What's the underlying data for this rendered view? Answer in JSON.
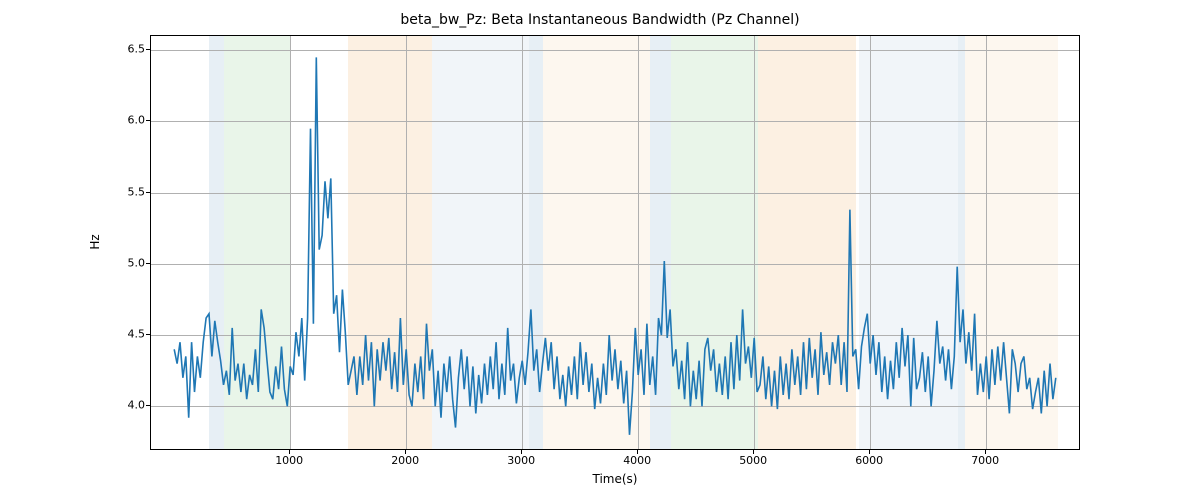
{
  "chart_data": {
    "type": "line",
    "title": "beta_bw_Pz: Beta Instantaneous Bandwidth (Pz Channel)",
    "xlabel": "Time(s)",
    "ylabel": "Hz",
    "xlim": [
      -200,
      7800
    ],
    "ylim": [
      3.7,
      6.6
    ],
    "xticks": [
      1000,
      2000,
      3000,
      4000,
      5000,
      6000,
      7000
    ],
    "yticks": [
      4.0,
      4.5,
      5.0,
      5.5,
      6.0,
      6.5
    ],
    "bands": [
      {
        "x0": 300,
        "x1": 430,
        "color": "#9fbfd9"
      },
      {
        "x0": 430,
        "x1": 1000,
        "color": "#a8d8a8"
      },
      {
        "x0": 1500,
        "x1": 2220,
        "color": "#f5c58b"
      },
      {
        "x0": 2220,
        "x1": 3060,
        "color": "#c8d8e8"
      },
      {
        "x0": 3060,
        "x1": 3180,
        "color": "#9fbfd9"
      },
      {
        "x0": 3180,
        "x1": 4100,
        "color": "#f8e0c0"
      },
      {
        "x0": 4100,
        "x1": 4280,
        "color": "#9fbfd9"
      },
      {
        "x0": 4280,
        "x1": 5030,
        "color": "#a8d8a8"
      },
      {
        "x0": 5030,
        "x1": 5080,
        "color": "#f5c58b"
      },
      {
        "x0": 5080,
        "x1": 5880,
        "color": "#f5c58b"
      },
      {
        "x0": 5900,
        "x1": 6760,
        "color": "#c8d8e8"
      },
      {
        "x0": 6760,
        "x1": 6820,
        "color": "#9fbfd9"
      },
      {
        "x0": 6820,
        "x1": 7620,
        "color": "#f8e0c0"
      }
    ],
    "series": [
      {
        "name": "beta_bw_Pz",
        "color": "#1f77b4",
        "x": [
          0,
          25,
          50,
          75,
          100,
          125,
          150,
          175,
          200,
          225,
          250,
          275,
          300,
          325,
          350,
          375,
          400,
          425,
          450,
          475,
          500,
          525,
          550,
          575,
          600,
          625,
          650,
          675,
          700,
          725,
          750,
          775,
          800,
          825,
          850,
          875,
          900,
          925,
          950,
          975,
          1000,
          1025,
          1050,
          1075,
          1100,
          1125,
          1150,
          1175,
          1200,
          1225,
          1250,
          1275,
          1300,
          1325,
          1350,
          1375,
          1400,
          1425,
          1450,
          1475,
          1500,
          1525,
          1550,
          1575,
          1600,
          1625,
          1650,
          1675,
          1700,
          1725,
          1750,
          1775,
          1800,
          1825,
          1850,
          1875,
          1900,
          1925,
          1950,
          1975,
          2000,
          2025,
          2050,
          2075,
          2100,
          2125,
          2150,
          2175,
          2200,
          2225,
          2250,
          2275,
          2300,
          2325,
          2350,
          2375,
          2400,
          2425,
          2450,
          2475,
          2500,
          2525,
          2550,
          2575,
          2600,
          2625,
          2650,
          2675,
          2700,
          2725,
          2750,
          2775,
          2800,
          2825,
          2850,
          2875,
          2900,
          2925,
          2950,
          2975,
          3000,
          3025,
          3050,
          3075,
          3100,
          3125,
          3150,
          3175,
          3200,
          3225,
          3250,
          3275,
          3300,
          3325,
          3350,
          3375,
          3400,
          3425,
          3450,
          3475,
          3500,
          3525,
          3550,
          3575,
          3600,
          3625,
          3650,
          3675,
          3700,
          3725,
          3750,
          3775,
          3800,
          3825,
          3850,
          3875,
          3900,
          3925,
          3950,
          3975,
          4000,
          4025,
          4050,
          4075,
          4100,
          4125,
          4150,
          4175,
          4200,
          4225,
          4250,
          4275,
          4300,
          4325,
          4350,
          4375,
          4400,
          4425,
          4450,
          4475,
          4500,
          4525,
          4550,
          4575,
          4600,
          4625,
          4650,
          4675,
          4700,
          4725,
          4750,
          4775,
          4800,
          4825,
          4850,
          4875,
          4900,
          4925,
          4950,
          4975,
          5000,
          5025,
          5050,
          5075,
          5100,
          5125,
          5150,
          5175,
          5200,
          5225,
          5250,
          5275,
          5300,
          5325,
          5350,
          5375,
          5400,
          5425,
          5450,
          5475,
          5500,
          5525,
          5550,
          5575,
          5600,
          5625,
          5650,
          5675,
          5700,
          5725,
          5750,
          5775,
          5800,
          5825,
          5850,
          5875,
          5900,
          5925,
          5950,
          5975,
          6000,
          6025,
          6050,
          6075,
          6100,
          6125,
          6150,
          6175,
          6200,
          6225,
          6250,
          6275,
          6300,
          6325,
          6350,
          6375,
          6400,
          6425,
          6450,
          6475,
          6500,
          6525,
          6550,
          6575,
          6600,
          6625,
          6650,
          6675,
          6700,
          6725,
          6750,
          6775,
          6800,
          6825,
          6850,
          6875,
          6900,
          6925,
          6950,
          6975,
          7000,
          7025,
          7050,
          7075,
          7100,
          7125,
          7150,
          7175,
          7200,
          7225,
          7250,
          7275,
          7300,
          7325,
          7350,
          7375,
          7400,
          7425,
          7450,
          7475,
          7500,
          7525,
          7550,
          7575,
          7600
        ],
        "values": [
          4.4,
          4.3,
          4.45,
          4.2,
          4.35,
          3.92,
          4.45,
          4.1,
          4.35,
          4.2,
          4.45,
          4.62,
          4.65,
          4.35,
          4.6,
          4.45,
          4.32,
          4.15,
          4.25,
          4.08,
          4.55,
          4.18,
          4.3,
          4.1,
          4.3,
          4.05,
          4.22,
          4.15,
          4.4,
          4.1,
          4.68,
          4.55,
          4.32,
          4.1,
          4.05,
          4.28,
          4.12,
          4.42,
          4.12,
          4.0,
          4.28,
          4.22,
          4.52,
          4.35,
          4.62,
          4.18,
          4.62,
          5.95,
          4.58,
          6.45,
          5.1,
          5.2,
          5.58,
          5.32,
          5.6,
          4.65,
          4.78,
          4.38,
          4.82,
          4.52,
          4.15,
          4.25,
          4.35,
          4.08,
          4.35,
          4.15,
          4.5,
          4.18,
          4.45,
          4.0,
          4.4,
          4.18,
          4.45,
          4.25,
          4.48,
          4.12,
          4.38,
          4.1,
          4.62,
          4.15,
          4.4,
          4.08,
          4.0,
          4.3,
          4.1,
          4.35,
          4.05,
          4.58,
          4.25,
          4.4,
          4.0,
          4.25,
          3.92,
          4.3,
          4.1,
          4.35,
          4.05,
          3.85,
          4.2,
          4.4,
          4.12,
          4.35,
          4.0,
          4.28,
          3.95,
          4.22,
          4.02,
          4.3,
          4.08,
          4.35,
          4.12,
          4.45,
          4.05,
          4.3,
          4.08,
          4.55,
          4.18,
          4.3,
          4.02,
          4.2,
          4.32,
          4.15,
          4.38,
          4.68,
          4.25,
          4.4,
          4.1,
          4.3,
          4.48,
          4.25,
          4.45,
          4.12,
          4.35,
          4.05,
          4.22,
          4.0,
          4.28,
          4.08,
          4.35,
          4.05,
          4.45,
          4.15,
          4.38,
          4.1,
          4.3,
          3.98,
          4.2,
          4.02,
          4.3,
          4.08,
          4.5,
          4.18,
          4.4,
          4.12,
          4.32,
          4.02,
          4.25,
          3.8,
          4.1,
          4.55,
          4.22,
          4.4,
          4.08,
          4.58,
          4.15,
          4.35,
          4.08,
          4.62,
          4.5,
          5.02,
          4.48,
          4.68,
          4.28,
          4.4,
          4.12,
          4.32,
          4.05,
          4.45,
          4.0,
          4.25,
          4.05,
          4.32,
          4.0,
          4.4,
          4.48,
          4.25,
          4.4,
          4.1,
          4.3,
          4.08,
          4.35,
          4.05,
          4.45,
          4.12,
          4.5,
          4.18,
          4.68,
          4.3,
          4.42,
          4.2,
          4.48,
          4.1,
          4.15,
          4.35,
          4.05,
          4.28,
          4.0,
          4.25,
          3.98,
          4.35,
          4.08,
          4.3,
          4.05,
          4.4,
          4.15,
          4.35,
          4.08,
          4.45,
          4.12,
          4.48,
          4.2,
          4.4,
          4.08,
          4.52,
          4.22,
          4.38,
          4.15,
          4.45,
          4.3,
          4.5,
          4.15,
          4.45,
          4.1,
          5.38,
          4.35,
          4.4,
          4.12,
          4.42,
          4.55,
          4.65,
          4.3,
          4.5,
          4.22,
          4.45,
          4.1,
          4.35,
          4.05,
          4.32,
          4.12,
          4.45,
          4.2,
          4.55,
          4.28,
          4.5,
          4.0,
          4.48,
          4.12,
          4.2,
          4.38,
          4.1,
          4.35,
          4.0,
          4.25,
          4.6,
          4.3,
          4.42,
          4.18,
          4.4,
          4.12,
          4.35,
          4.98,
          4.45,
          4.68,
          4.3,
          4.52,
          4.25,
          4.65,
          4.08,
          4.3,
          4.1,
          4.35,
          4.05,
          4.4,
          4.15,
          4.42,
          4.18,
          4.45,
          4.2,
          3.95,
          4.4,
          4.3,
          4.1,
          4.3,
          4.35,
          4.12,
          4.2,
          3.98,
          4.1,
          4.2,
          3.95,
          4.25,
          4.0,
          4.3,
          4.05,
          4.2
        ]
      }
    ]
  }
}
